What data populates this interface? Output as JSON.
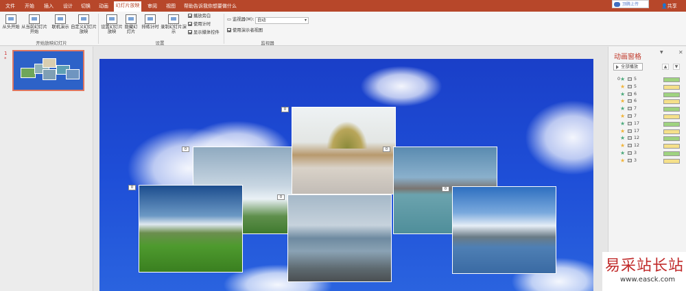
{
  "tabs": [
    "文件",
    "开始",
    "插入",
    "设计",
    "切换",
    "动画",
    "幻灯片放映",
    "审阅",
    "视图",
    "帮助"
  ],
  "tell_me": "告诉我你想要做什么",
  "share_upload": "顶腾上传",
  "user_share": "共享",
  "ribbon": {
    "group1": {
      "label": "开始放映幻灯片",
      "buttons": [
        "从头开始",
        "从当前幻灯片开始",
        "联机演示",
        "自定义幻灯片放映"
      ]
    },
    "group2": {
      "label": "设置",
      "buttons": [
        "设置幻灯片放映",
        "隐藏幻灯片",
        "排练计时",
        "录制幻灯片演示"
      ],
      "checks": [
        "播放旁白",
        "使用计时",
        "显示媒体控件"
      ]
    },
    "group3": {
      "label": "监视器",
      "monitor_label": "监视器(M):",
      "monitor_value": "自动",
      "presenter_view": "使用演示者视图"
    }
  },
  "slide_number": "1",
  "slide_star": "*",
  "anim_pane": {
    "title": "动画窗格",
    "play_all": "全部播放",
    "up": "▲",
    "down": "▼",
    "rows": [
      {
        "n": "0",
        "star": "green",
        "num": "5",
        "bar": "#9fd380"
      },
      {
        "n": "",
        "star": "yellow",
        "num": "5",
        "bar": "#f5e08a"
      },
      {
        "n": "",
        "star": "green",
        "num": "6",
        "bar": "#9fd380"
      },
      {
        "n": "",
        "star": "yellow",
        "num": "6",
        "bar": "#f5e08a"
      },
      {
        "n": "",
        "star": "green",
        "num": "7",
        "bar": "#9fd380"
      },
      {
        "n": "",
        "star": "yellow",
        "num": "7",
        "bar": "#f5e08a"
      },
      {
        "n": "",
        "star": "green",
        "num": "17",
        "bar": "#9fd380"
      },
      {
        "n": "",
        "star": "yellow",
        "num": "17",
        "bar": "#f5e08a"
      },
      {
        "n": "",
        "star": "green",
        "num": "12",
        "bar": "#9fd380"
      },
      {
        "n": "",
        "star": "yellow",
        "num": "12",
        "bar": "#f5e08a"
      },
      {
        "n": "",
        "star": "green",
        "num": "3",
        "bar": "#9fd380"
      },
      {
        "n": "",
        "star": "yellow",
        "num": "3",
        "bar": "#f5e08a"
      }
    ]
  },
  "tags": [
    "0",
    "0",
    "0",
    "0",
    "0",
    "0"
  ],
  "watermark": {
    "cn": "易采站长站",
    "url": "www.easck.com"
  },
  "colors": {
    "accent": "#b7472a",
    "green_star": "#4aa87a",
    "yellow_star": "#f0b43a"
  }
}
